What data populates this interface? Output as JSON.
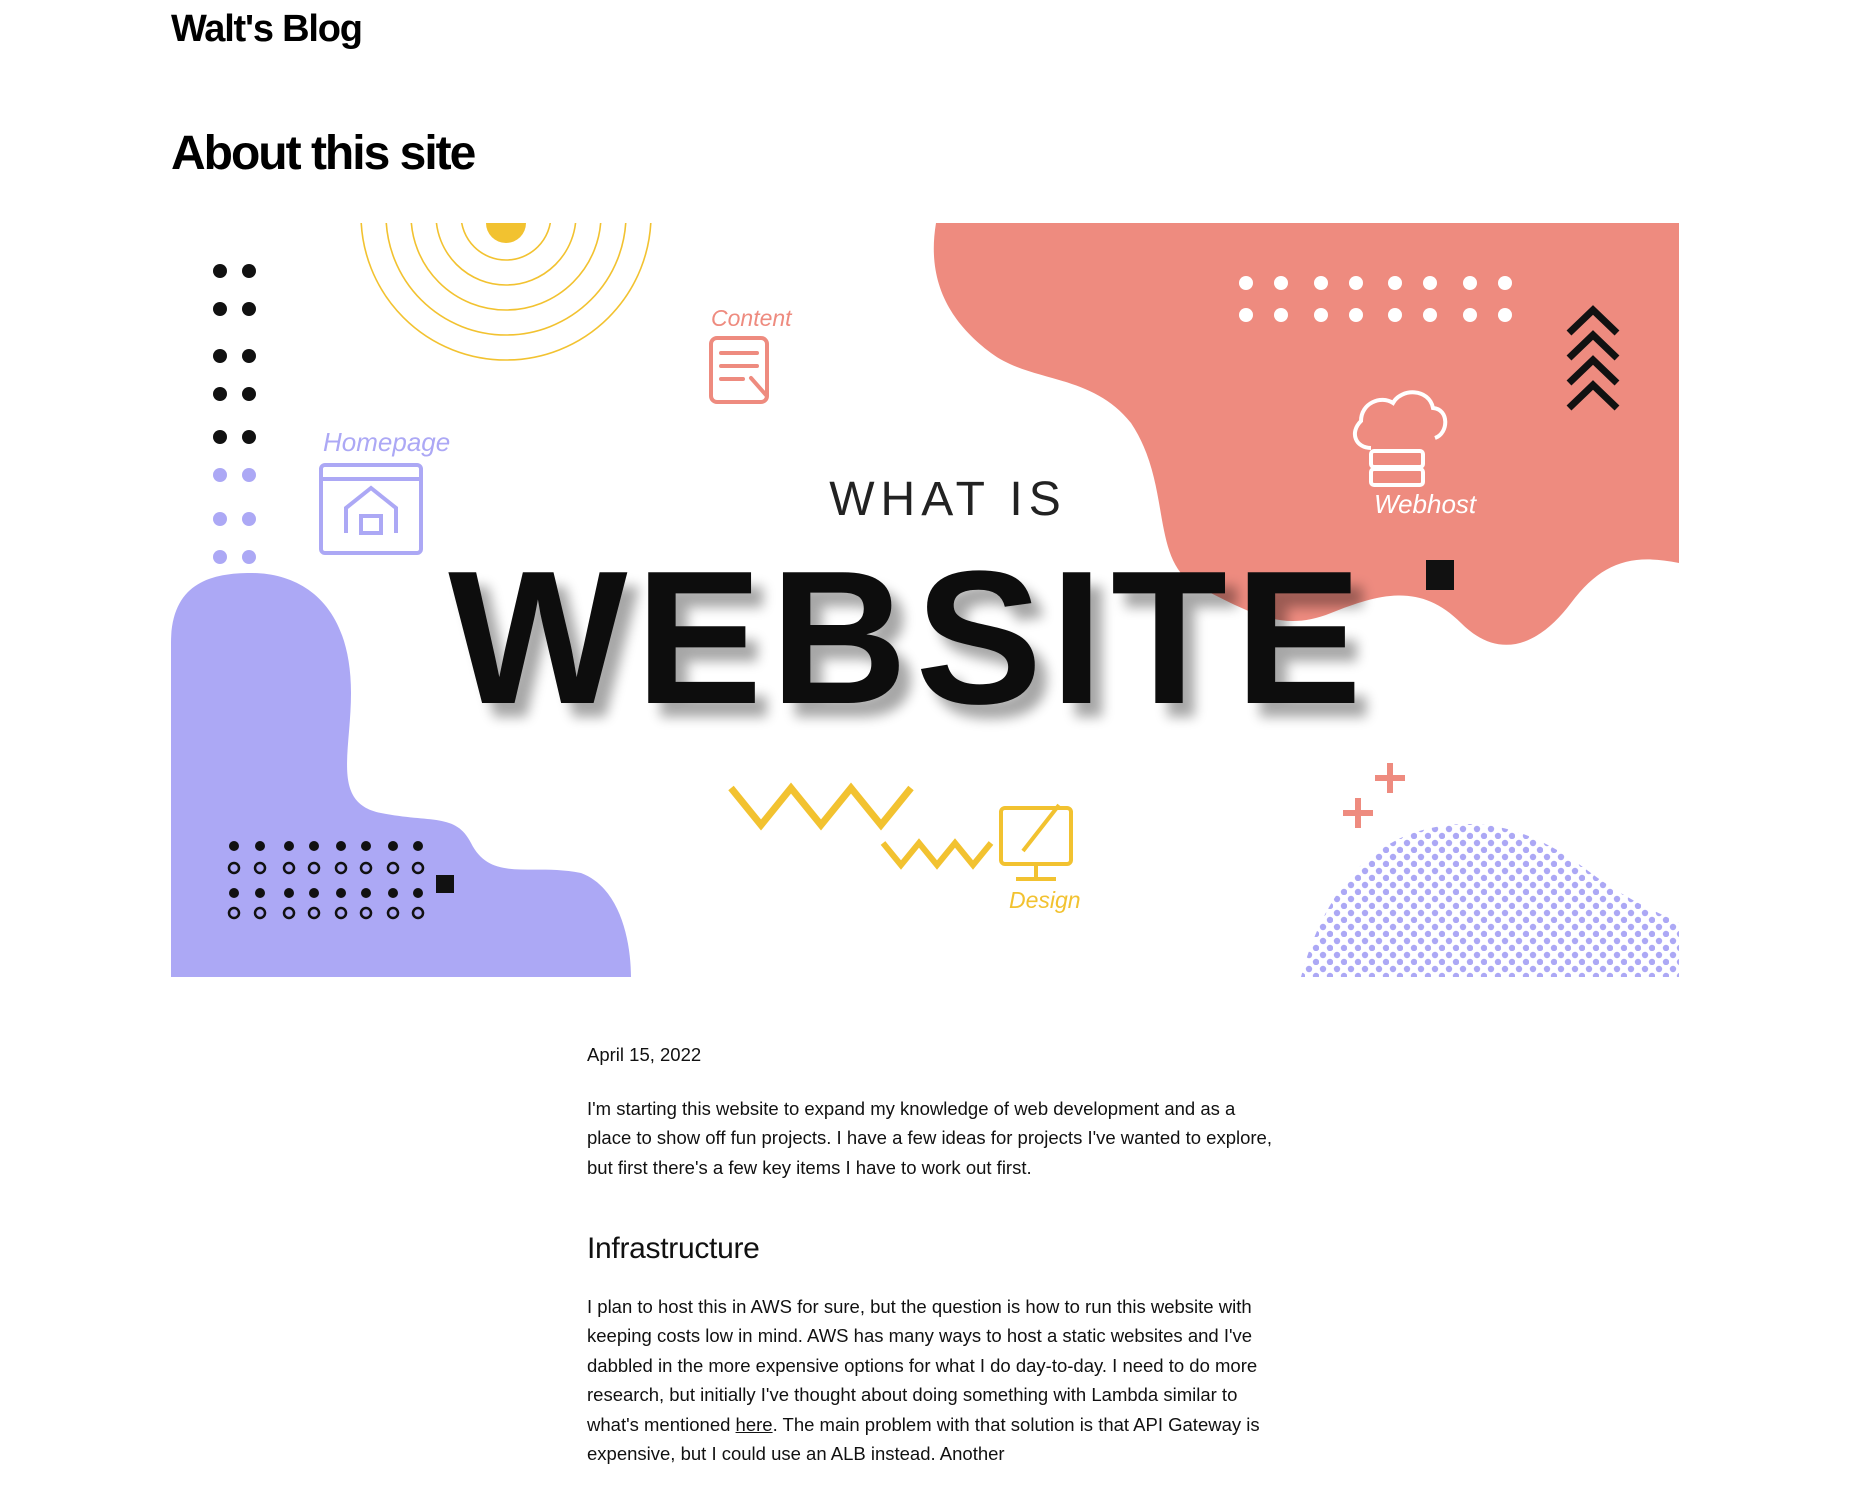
{
  "header": {
    "site_title": "Walt's Blog"
  },
  "page": {
    "title": "About this site"
  },
  "hero_image": {
    "alt": "What is website illustration",
    "small_heading": "WHAT IS",
    "big_heading": "WEBSITE",
    "labels": {
      "content": "Content",
      "homepage": "Homepage",
      "webhost": "Webhost",
      "design": "Design"
    },
    "colors": {
      "coral": "#EE8B7F",
      "lavender": "#ACA8F5",
      "yellow": "#F2C230",
      "black": "#111111"
    }
  },
  "post": {
    "date": "April 15, 2022",
    "intro": "I'm starting this website to expand my knowledge of web development and as a place to show off fun projects. I have a few ideas for projects I've wanted to explore, but first there's a few key items I have to work out first.",
    "sections": [
      {
        "heading": "Infrastructure",
        "text_before_link": "I plan to host this in AWS for sure, but the question is how to run this website with keeping costs low in mind. AWS has many ways to host a static websites and I've dabbled in the more expensive options for what I do day-to-day. I need to do more research, but initially I've thought about doing something with Lambda similar to what's mentioned ",
        "link_text": "here",
        "text_after_link": ". The main problem with that solution is that API Gateway is expensive, but I could use an ALB instead. Another"
      }
    ]
  }
}
